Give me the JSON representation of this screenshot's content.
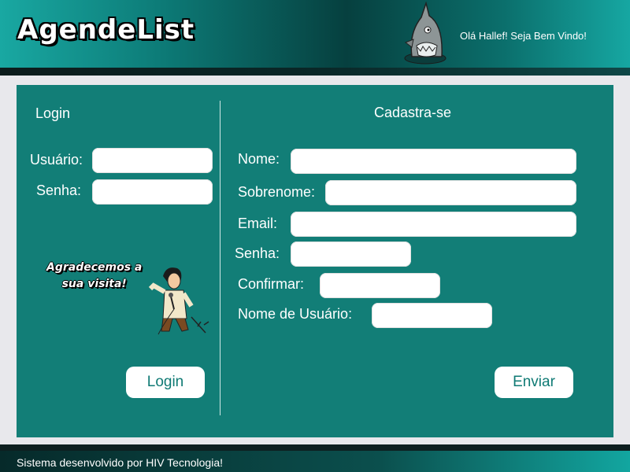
{
  "header": {
    "logo_text": "AgendeList",
    "welcome": "Olá Hallef! Seja Bem Vindo!"
  },
  "login": {
    "title": "Login",
    "username_label": "Usuário:",
    "password_label": "Senha:",
    "button_label": "Login",
    "thanks_line1": "Agradecemos a",
    "thanks_line2": "sua visita!"
  },
  "register": {
    "title": "Cadastra-se",
    "name_label": "Nome:",
    "surname_label": "Sobrenome:",
    "email_label": "Email:",
    "password_label": "Senha:",
    "confirm_label": "Confirmar:",
    "username_label": "Nome de Usuário:",
    "button_label": "Enviar"
  },
  "footer": {
    "text": "Sistema desenvolvido por HIV Tecnologia!"
  },
  "colors": {
    "panel": "#127e77",
    "accent_text": "#0f7a74"
  },
  "icons": [
    "shark-icon",
    "singer-illustration"
  ]
}
